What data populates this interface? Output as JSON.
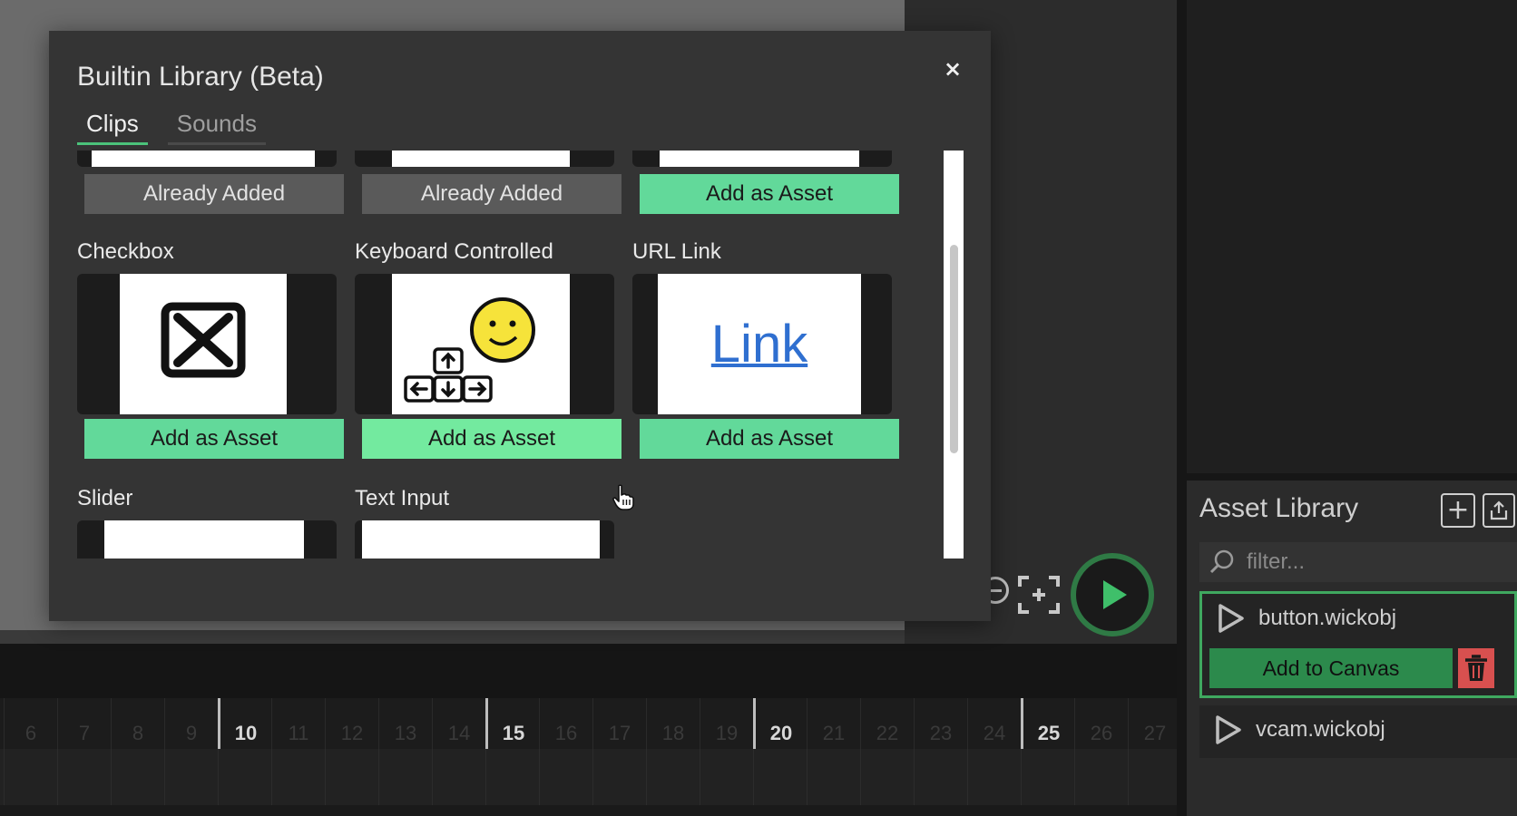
{
  "modal": {
    "title": "Builtin Library (Beta)",
    "close_label": "×",
    "tabs": [
      {
        "label": "Clips",
        "active": true
      },
      {
        "label": "Sounds",
        "active": false
      }
    ]
  },
  "clips": {
    "top_row_buttons": [
      "Already Added",
      "Already Added",
      "Add as Asset"
    ],
    "items": [
      {
        "name": "Checkbox",
        "button": "Add as Asset"
      },
      {
        "name": "Keyboard Controlled",
        "button": "Add as Asset"
      },
      {
        "name": "URL Link",
        "button": "Add as Asset",
        "preview_text": "Link"
      },
      {
        "name": "Slider"
      },
      {
        "name": "Text Input"
      }
    ]
  },
  "asset_library": {
    "title": "Asset Library",
    "filter_placeholder": "filter...",
    "items": [
      {
        "name": "button.wickobj",
        "selected": true
      },
      {
        "name": "vcam.wickobj",
        "selected": false
      }
    ],
    "add_to_canvas_label": "Add to Canvas"
  },
  "timeline": {
    "frames": [
      "6",
      "7",
      "8",
      "9",
      "10",
      "11",
      "12",
      "13",
      "14",
      "15",
      "16",
      "17",
      "18",
      "19",
      "20",
      "21",
      "22",
      "23",
      "24",
      "25",
      "26",
      "27"
    ],
    "major_frames": [
      "10",
      "15",
      "20",
      "25"
    ]
  },
  "colors": {
    "accent_green": "#62d99a",
    "selected_border": "#3fa85f",
    "delete_red": "#d8504f"
  }
}
